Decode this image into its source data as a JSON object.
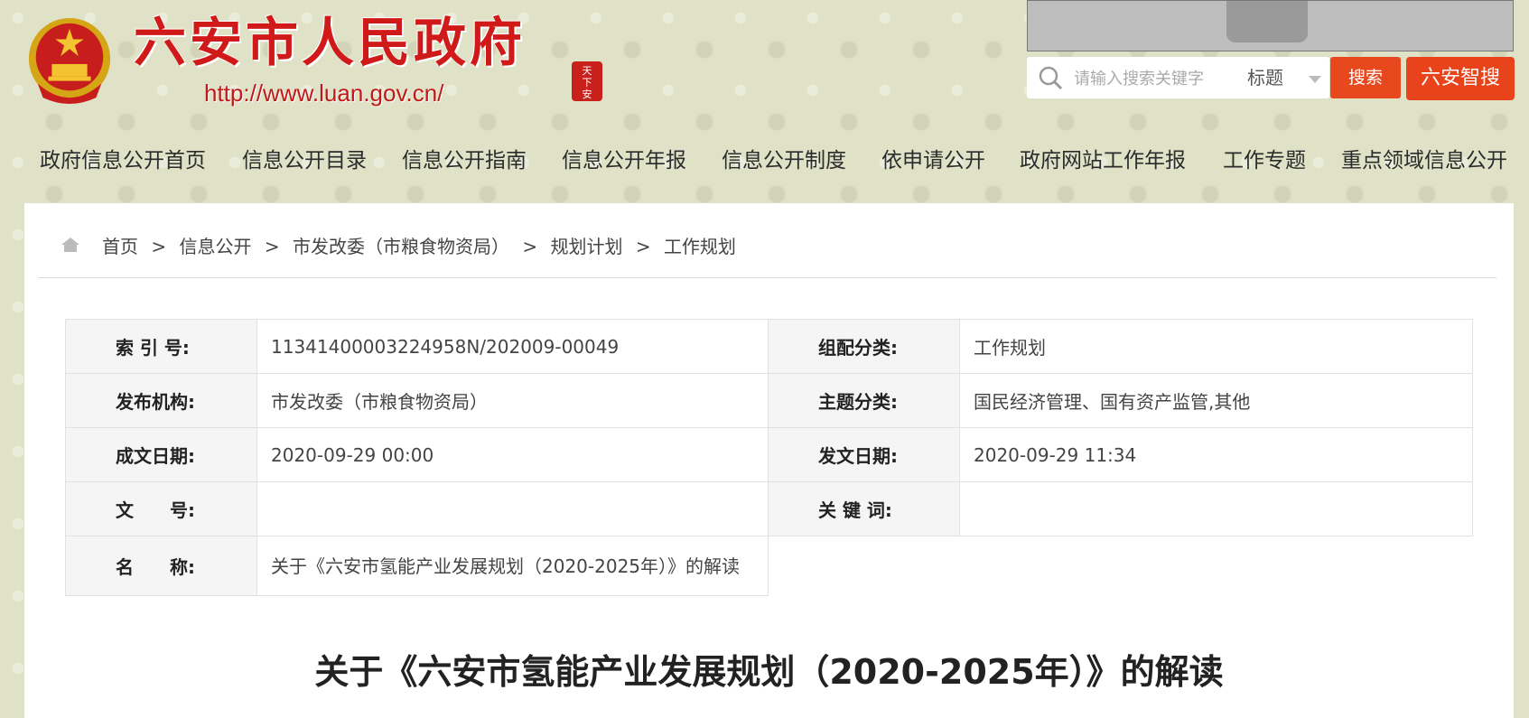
{
  "header": {
    "site_title": "六安市人民政府",
    "site_url": "http://www.luan.gov.cn/",
    "seal_text": "天下安",
    "search": {
      "placeholder": "请输入搜索关键字",
      "scope": "标题",
      "search_button": "搜索",
      "smart_button": "六安智搜"
    },
    "accent_color": "#e8481e",
    "title_color": "#d01a1a"
  },
  "nav": {
    "items": [
      "政府信息公开首页",
      "信息公开目录",
      "信息公开指南",
      "信息公开年报",
      "信息公开制度",
      "依申请公开",
      "政府网站工作年报",
      "工作专题",
      "重点领域信息公开"
    ]
  },
  "breadcrumb": {
    "items": [
      "首页",
      "信息公开",
      "市发改委（市粮食物资局）",
      "规划计划",
      "工作规划"
    ],
    "separator": ">"
  },
  "meta": {
    "index_label": "索 引 号:",
    "index_value": "11341400003224958N/202009-00049",
    "category_label": "组配分类:",
    "category_value": "工作规划",
    "publisher_label": "发布机构:",
    "publisher_value": "市发改委（市粮食物资局）",
    "topic_label": "主题分类:",
    "topic_value": "国民经济管理、国有资产监管,其他",
    "created_label": "成文日期:",
    "created_value": "2020-09-29 00:00",
    "published_label": "发文日期:",
    "published_value": "2020-09-29 11:34",
    "docno_label": "文　　号:",
    "docno_value": "",
    "keywords_label": "关 键 词:",
    "keywords_value": "",
    "name_label": "名　　称:",
    "name_value": "关于《六安市氢能产业发展规划（2020-2025年）》的解读"
  },
  "article": {
    "title": "关于《六安市氢能产业发展规划（2020-2025年）》的解读"
  }
}
